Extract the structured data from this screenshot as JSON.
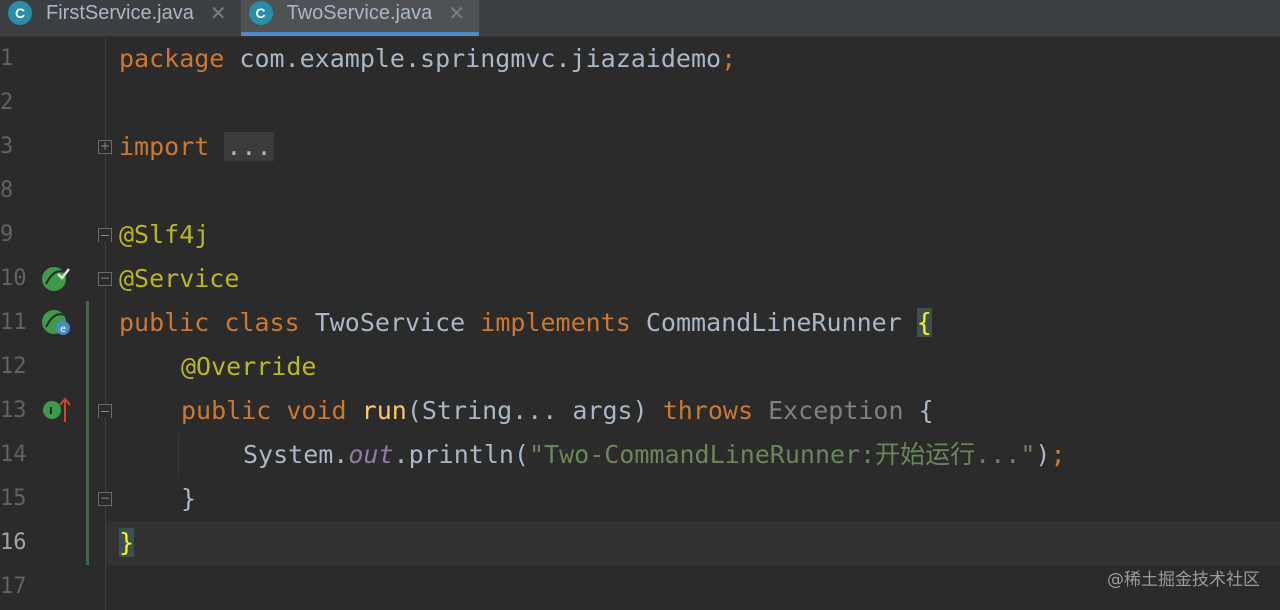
{
  "tabs": [
    {
      "icon": "C",
      "label": "FirstService.java",
      "close": "✕"
    },
    {
      "icon": "C",
      "label": "TwoService.java",
      "close": "✕"
    }
  ],
  "line_numbers": [
    "1",
    "2",
    "3",
    "8",
    "9",
    "10",
    "11",
    "12",
    "13",
    "14",
    "15",
    "16",
    "17"
  ],
  "code": {
    "l1_kw": "package",
    "l1_rest": " com.example.springmvc.jiazaidemo",
    "l1_semi": ";",
    "l3_kw": "import",
    "l3_dots": "...",
    "l9_ann": "@Slf4j",
    "l10_ann": "@Service",
    "l11_kw1": "public",
    "l11_kw2": "class",
    "l11_name": "TwoService",
    "l11_kw3": "implements",
    "l11_iface": "CommandLineRunner",
    "l11_brace": "{",
    "l12_ann": "@Override",
    "l13_kw1": "public",
    "l13_kw2": "void",
    "l13_fn": "run",
    "l13_params": "(String... args)",
    "l13_kw3": "throws",
    "l13_exc": "Exception",
    "l13_brace": "{",
    "l14_sys": "System.",
    "l14_out": "out",
    "l14_call": ".println(",
    "l14_str": "\"Two-CommandLineRunner:开始运行...\"",
    "l14_close": ")",
    "l14_semi": ";",
    "l15_brace": "}",
    "l16_brace": "}"
  },
  "watermark": "@稀土掘金技术社区",
  "colors": {
    "background": "#2b2b2b",
    "keyword": "#cc7832",
    "annotation": "#bbb529",
    "function": "#ffc66d",
    "string": "#6a8759",
    "field": "#9876aa",
    "accent": "#4a88c7"
  },
  "gutter_icons": {
    "line10": "bean-check-icon",
    "line11": "bean-implements-icon",
    "line13": "override-method-icon"
  }
}
